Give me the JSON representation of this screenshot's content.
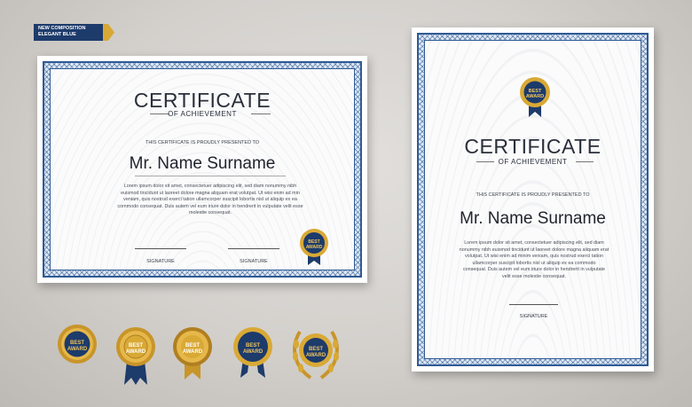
{
  "banner": {
    "line1": "NEW COMPOSITION",
    "line2": "ELEGANT BLUE"
  },
  "certificate": {
    "title": "CERTIFICATE",
    "subtitle": "OF ACHIEVEMENT",
    "presented": "THIS CERTIFICATE IS PROUDLY PRESENTED TO",
    "name": "Mr. Name Surname",
    "body_landscape": [
      "Lorem ipsum dolor sit amet, consectetuer adipiscing elit, sed diam nonummy nibh",
      "euismod tincidunt ut laoreet dolore magna aliquam erat volutpat. Ut wisi enim ad min",
      "veniam, quis nostrud exerci tation ullamcorper suscipit lobortis nisl ut aliquip ex ea",
      "commodo consequat. Duis autem vel eum iriure dolor in hendrerit in vulputate velit esse",
      "molestie consequat."
    ],
    "body_portrait": [
      "Lorem ipsum dolor sit amet, consectetuer adipiscing elit, sed diam",
      "nonummy nibh euismod tincidunt ut laoreet dolore magna aliquam erat",
      "volutpat. Ut wisi enim ad minim veniam, quis nostrud exerci tation",
      "ullamcorper suscipit lobortis nisl ut aliquip ex ea commodo",
      "consequat. Duis autem vel eum iriure dolor in hendrerit in vulputate",
      "velit esse molestie consequat."
    ],
    "signature": "SIGNATURE"
  },
  "badge": {
    "line1": "BEST",
    "line2": "AWARD"
  },
  "colors": {
    "navy": "#1d3b6b",
    "gold": "#d9a935",
    "border": "#2f5a94"
  }
}
